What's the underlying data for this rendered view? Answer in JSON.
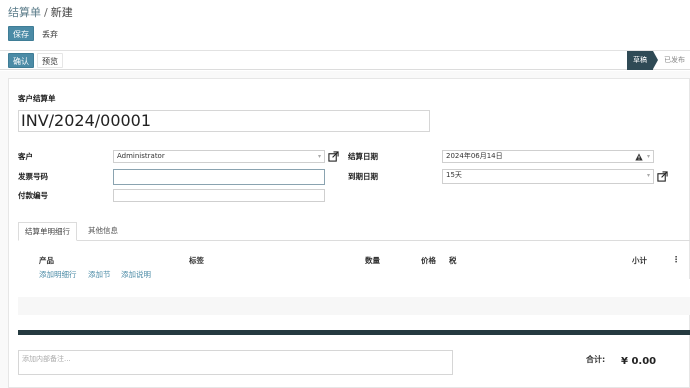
{
  "breadcrumb": {
    "parent": "结算单",
    "separator": "/",
    "current": "新建"
  },
  "toolbar": {
    "save_label": "保存",
    "discard_label": "丢弃"
  },
  "statusbar": {
    "confirm_label": "确认",
    "preview_label": "预览",
    "stage_draft": "草稿",
    "stage_posted": "已发布"
  },
  "form": {
    "doc_type_label": "客户结算单",
    "doc_number": "INV/2024/00001",
    "customer_label": "客户",
    "customer_value": "Administrator",
    "invoice_no_label": "发票号码",
    "invoice_no_value": "",
    "payment_ref_label": "付款编号",
    "payment_ref_value": "",
    "date_label": "结算日期",
    "date_value": "2024年06月14日",
    "due_label": "到期日期",
    "due_value": "15天"
  },
  "tabs": [
    {
      "label": "结算单明细行"
    },
    {
      "label": "其他信息"
    }
  ],
  "lines": {
    "columns": {
      "product": "产品",
      "label": "标签",
      "quantity": "数量",
      "price": "价格",
      "tax": "税",
      "subtotal": "小计"
    },
    "add_line": "添加明细行",
    "add_section": "添加节",
    "add_note": "添加说明"
  },
  "notes": {
    "placeholder": "添加内部备注..."
  },
  "totals": {
    "label": "合计:",
    "value": "¥ 0.00"
  },
  "colors": {
    "primary": "#4b8ba6",
    "dark_bar": "#253a40",
    "stage_active": "#2f4a55"
  },
  "icons": [
    "external-link-icon",
    "warning-icon",
    "chevron-down-icon",
    "column-options-icon"
  ]
}
